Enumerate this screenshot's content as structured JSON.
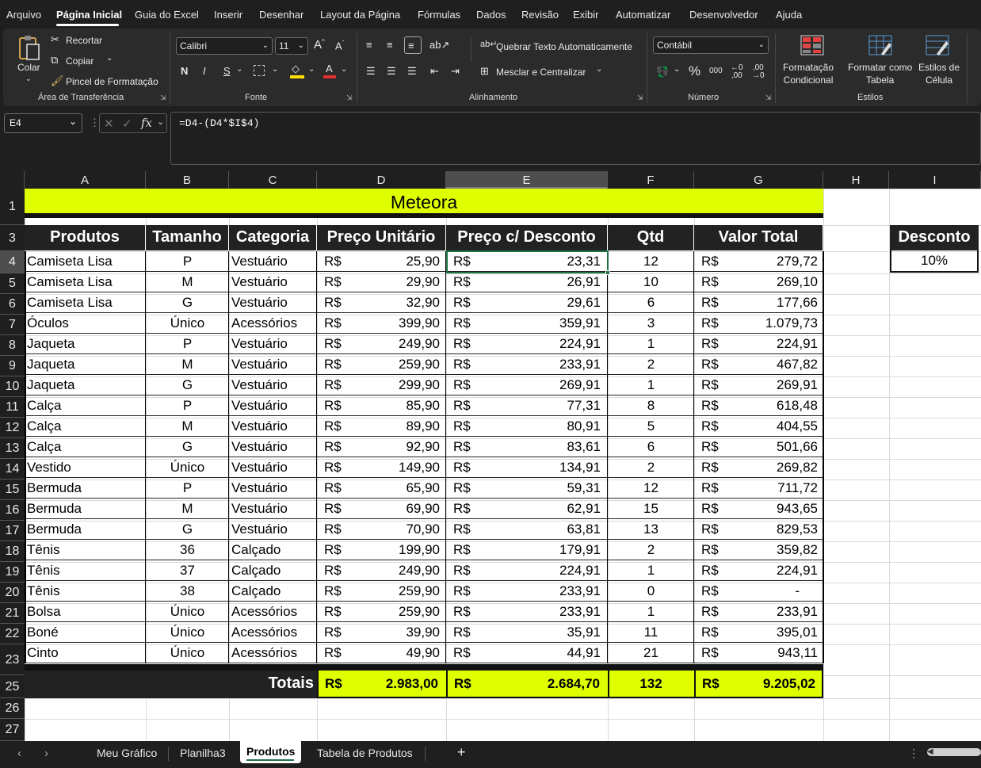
{
  "menu": [
    "Arquivo",
    "Página Inicial",
    "Guia do Excel",
    "Inserir",
    "Desenhar",
    "Layout da Página",
    "Fórmulas",
    "Dados",
    "Revisão",
    "Exibir",
    "Automatizar",
    "Desenvolvedor",
    "Ajuda"
  ],
  "clipboard": {
    "paste": "Colar",
    "cut": "Recortar",
    "copy": "Copiar",
    "format_painter": "Pincel de Formatação",
    "group": "Área de Transferência"
  },
  "font": {
    "name": "Calibri",
    "size": "11",
    "group": "Fonte",
    "bold": "N",
    "italic": "I",
    "underline": "S"
  },
  "alignment": {
    "wrap": "Quebrar Texto Automaticamente",
    "merge": "Mesclar e Centralizar",
    "group": "Alinhamento"
  },
  "number": {
    "format": "Contábil",
    "group": "Número",
    "percent": "%",
    "thousands": "000"
  },
  "styles": {
    "conditional": "Formatação\nCondicional",
    "as_table": "Formatar como\nTabela",
    "cell_styles": "Estilos de\nCélula",
    "group": "Estilos"
  },
  "formula_bar": {
    "name_box": "E4",
    "fx": "fx",
    "formula": "=D4-(D4*$I$4)"
  },
  "columns": [
    "A",
    "B",
    "C",
    "D",
    "E",
    "F",
    "G",
    "H",
    "I"
  ],
  "rows": [
    "1",
    "3",
    "4",
    "5",
    "6",
    "7",
    "8",
    "9",
    "10",
    "11",
    "12",
    "13",
    "14",
    "15",
    "16",
    "17",
    "18",
    "19",
    "20",
    "21",
    "22",
    "23",
    "25",
    "26",
    "27"
  ],
  "sheet": {
    "title": "Meteora",
    "headers": [
      "Produtos",
      "Tamanho",
      "Categoria",
      "Preço Unitário",
      "Preço c/ Desconto",
      "Qtd",
      "Valor Total"
    ],
    "currency": "R$",
    "data": [
      [
        "Camiseta Lisa",
        "P",
        "Vestuário",
        "25,90",
        "23,31",
        "12",
        "279,72"
      ],
      [
        "Camiseta Lisa",
        "M",
        "Vestuário",
        "29,90",
        "26,91",
        "10",
        "269,10"
      ],
      [
        "Camiseta Lisa",
        "G",
        "Vestuário",
        "32,90",
        "29,61",
        "6",
        "177,66"
      ],
      [
        "Óculos",
        "Único",
        "Acessórios",
        "399,90",
        "359,91",
        "3",
        "1.079,73"
      ],
      [
        "Jaqueta",
        "P",
        "Vestuário",
        "249,90",
        "224,91",
        "1",
        "224,91"
      ],
      [
        "Jaqueta",
        "M",
        "Vestuário",
        "259,90",
        "233,91",
        "2",
        "467,82"
      ],
      [
        "Jaqueta",
        "G",
        "Vestuário",
        "299,90",
        "269,91",
        "1",
        "269,91"
      ],
      [
        "Calça",
        "P",
        "Vestuário",
        "85,90",
        "77,31",
        "8",
        "618,48"
      ],
      [
        "Calça",
        "M",
        "Vestuário",
        "89,90",
        "80,91",
        "5",
        "404,55"
      ],
      [
        "Calça",
        "G",
        "Vestuário",
        "92,90",
        "83,61",
        "6",
        "501,66"
      ],
      [
        "Vestido",
        "Único",
        "Vestuário",
        "149,90",
        "134,91",
        "2",
        "269,82"
      ],
      [
        "Bermuda",
        "P",
        "Vestuário",
        "65,90",
        "59,31",
        "12",
        "711,72"
      ],
      [
        "Bermuda",
        "M",
        "Vestuário",
        "69,90",
        "62,91",
        "15",
        "943,65"
      ],
      [
        "Bermuda",
        "G",
        "Vestuário",
        "70,90",
        "63,81",
        "13",
        "829,53"
      ],
      [
        "Tênis",
        "36",
        "Calçado",
        "199,90",
        "179,91",
        "2",
        "359,82"
      ],
      [
        "Tênis",
        "37",
        "Calçado",
        "249,90",
        "224,91",
        "1",
        "224,91"
      ],
      [
        "Tênis",
        "38",
        "Calçado",
        "259,90",
        "233,91",
        "0",
        "-"
      ],
      [
        "Bolsa",
        "Único",
        "Acessórios",
        "259,90",
        "233,91",
        "1",
        "233,91"
      ],
      [
        "Boné",
        "Único",
        "Acessórios",
        "39,90",
        "35,91",
        "11",
        "395,01"
      ],
      [
        "Cinto",
        "Único",
        "Acessórios",
        "49,90",
        "44,91",
        "21",
        "943,11"
      ]
    ],
    "totals": {
      "label": "Totais",
      "unit_price": "2.983,00",
      "discount_price": "2.684,70",
      "qty": "132",
      "total": "9.205,02"
    },
    "discount": {
      "label": "Desconto",
      "value": "10%"
    }
  },
  "tabs": [
    "Meu Gráfico",
    "Planilha3",
    "Produtos",
    "Tabela de Produtos"
  ],
  "active_tab": "Produtos",
  "colors": {
    "accent": "#dfff00",
    "header_bg": "#222222",
    "app_bg": "#1f1f1f",
    "ribbon_bg": "#2b2b2b",
    "selection": "#217346"
  }
}
